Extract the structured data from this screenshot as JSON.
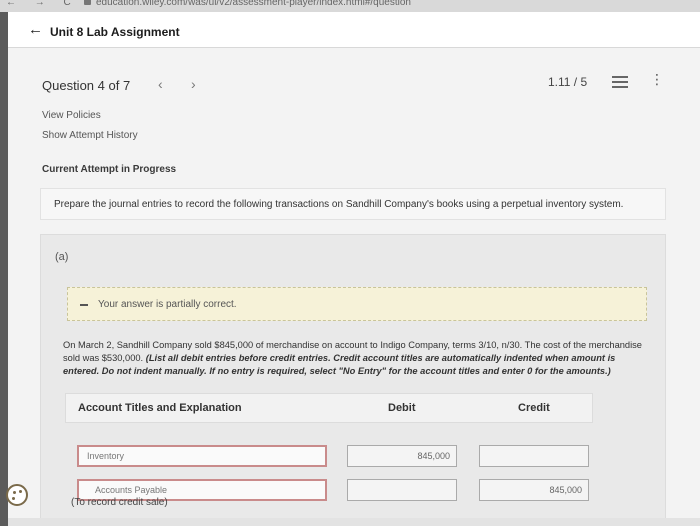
{
  "browser": {
    "nav_icons": "← → C",
    "url": "education.wiley.com/was/ui/v2/assessment-player/index.html#/question"
  },
  "header": {
    "back_icon": "←",
    "title": "Unit 8 Lab Assignment"
  },
  "question_nav": {
    "label": "Question 4 of 7",
    "prev_icon": "‹",
    "next_icon": "›",
    "score": "1.11 / 5",
    "menu_icon": "⋮"
  },
  "links": {
    "view_policies": "View Policies",
    "show_attempt_history": "Show Attempt History"
  },
  "attempt_status": "Current Attempt in Progress",
  "instructions": "Prepare the journal entries to record the following transactions on Sandhill Company's books using a perpetual inventory system.",
  "part": {
    "label": "(a)",
    "alert": "Your answer is partially correct.",
    "problem_text": "On March 2, Sandhill Company sold $845,000 of merchandise on account to Indigo Company, terms 3/10, n/30. The cost of the merchandise sold was $530,000.",
    "problem_instructions": "(List all debit entries before credit entries. Credit account titles are automatically indented when amount is entered. Do not indent manually. If no entry is required, select \"No Entry\" for the account titles and enter 0 for the amounts.)"
  },
  "table": {
    "headers": {
      "account": "Account Titles and Explanation",
      "debit": "Debit",
      "credit": "Credit"
    },
    "rows": [
      {
        "account": "Inventory",
        "debit": "845,000",
        "credit": ""
      },
      {
        "account": "Accounts Payable",
        "debit": "",
        "credit": "845,000"
      }
    ],
    "memo": "(To record credit sale)"
  },
  "colors": {
    "error_border": "#c98b8b",
    "alert_bg": "#f6f2d8"
  }
}
